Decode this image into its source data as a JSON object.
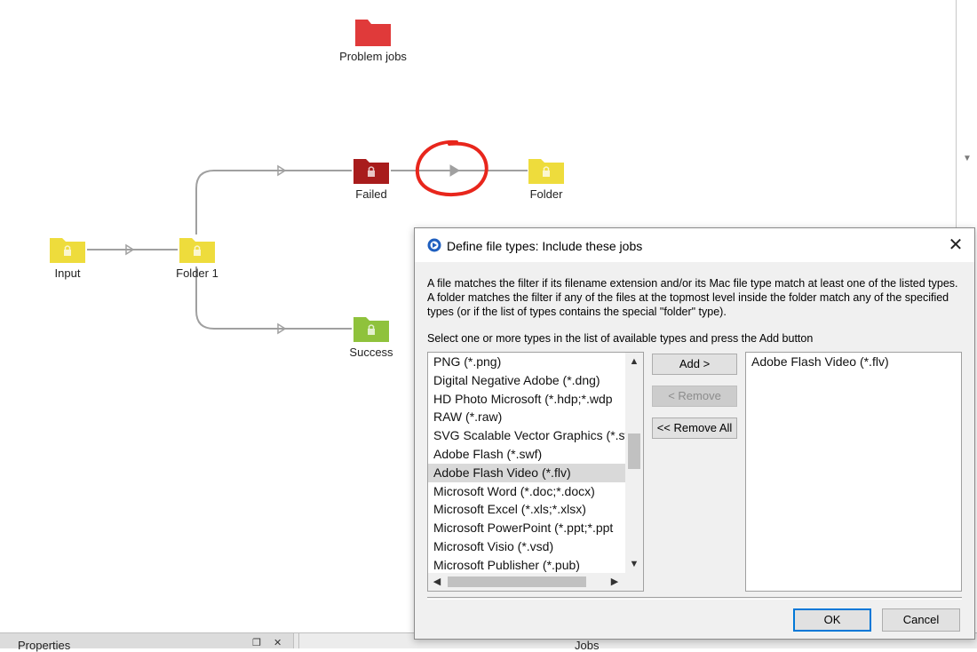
{
  "flow": {
    "nodes": [
      {
        "id": "problem-jobs",
        "label": "Problem jobs",
        "color": "#e03a3a",
        "locked": false
      },
      {
        "id": "failed",
        "label": "Failed",
        "color": "#a81c1c",
        "locked": true
      },
      {
        "id": "folder",
        "label": "Folder",
        "color": "#eedc3c",
        "locked": true
      },
      {
        "id": "input",
        "label": "Input",
        "color": "#eedc3c",
        "locked": true
      },
      {
        "id": "folder-1",
        "label": "Folder 1",
        "color": "#eedc3c",
        "locked": true
      },
      {
        "id": "success",
        "label": "Success",
        "color": "#8fc23c",
        "locked": true
      }
    ],
    "connector_color": "#a0a0a0",
    "highlight_color": "#e8261c"
  },
  "dialog": {
    "title": "Define file types: Include these jobs",
    "description": "A file matches the filter if its filename extension and/or its Mac file type match at least one of the listed types. A folder matches the filter if any of the files at the topmost level inside the folder match any of the specified types (or if the list of types contains the special \"folder\" type).",
    "instruction": "Select one or more types in the list of available types and press the Add button",
    "available_types": [
      "PNG (*.png)",
      "Digital Negative Adobe (*.dng)",
      "HD Photo Microsoft (*.hdp;*.wdp",
      "RAW (*.raw)",
      "SVG Scalable Vector Graphics (*.sv",
      "Adobe Flash (*.swf)",
      "Adobe Flash Video (*.flv)",
      "Microsoft Word (*.doc;*.docx)",
      "Microsoft Excel (*.xls;*.xlsx)",
      "Microsoft PowerPoint (*.ppt;*.ppt",
      "Microsoft Visio (*.vsd)",
      "Microsoft Publisher (*.pub)"
    ],
    "selected_available": "Adobe Flash Video (*.flv)",
    "selected_types": [
      "Adobe Flash Video (*.flv)"
    ],
    "buttons": {
      "add": "Add >",
      "remove": "< Remove",
      "remove_all": "<< Remove All",
      "ok": "OK",
      "cancel": "Cancel"
    },
    "scroll_position": 0.42
  },
  "bottom_panel": {
    "properties_label": "Properties",
    "jobs_label": "Jobs"
  }
}
